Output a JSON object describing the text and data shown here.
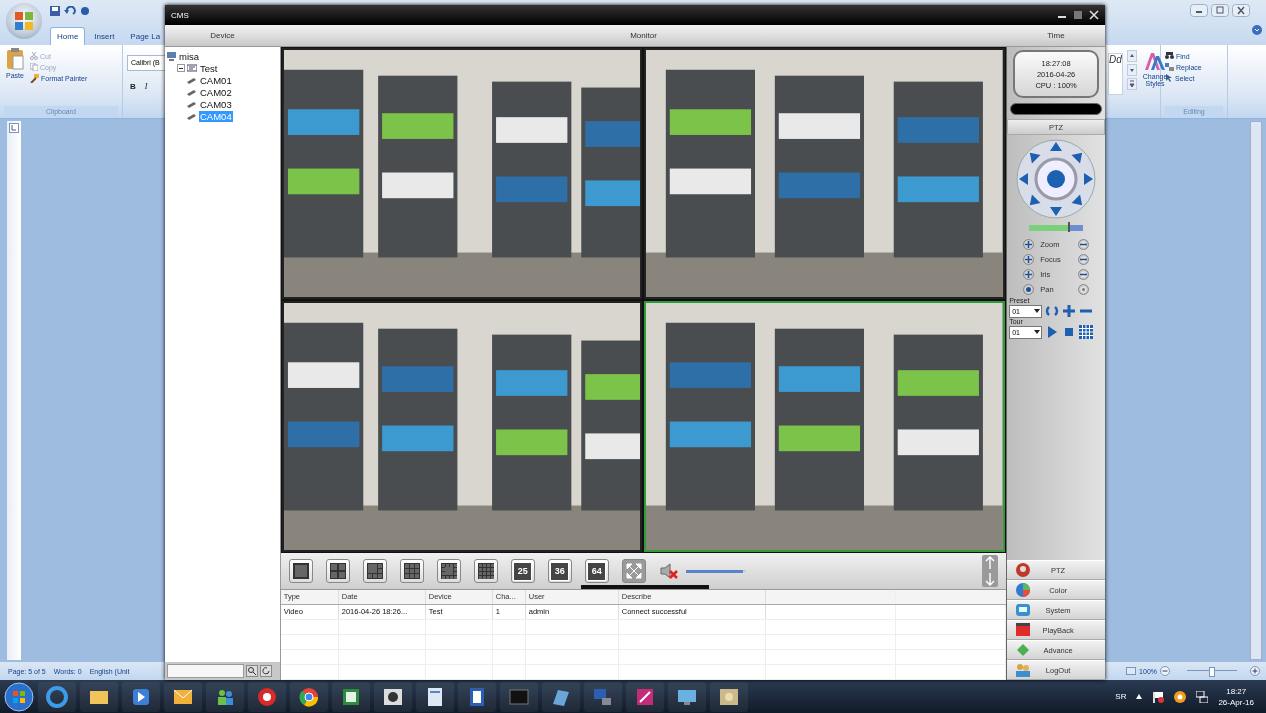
{
  "word": {
    "tabs": [
      {
        "label": "Home",
        "selected": true
      },
      {
        "label": "Insert",
        "selected": false
      },
      {
        "label": "Page La",
        "selected": false
      }
    ],
    "clipboard": {
      "paste": "Paste",
      "cut": "Cut",
      "copy": "Copy",
      "format_painter": "Format Painter",
      "group_label": "Clipboard"
    },
    "font": {
      "name": "Calibri (B",
      "bold": "B",
      "italic": "I"
    },
    "styles_preview": "Dd",
    "change_styles": "Change Styles",
    "editing": {
      "find": "Find",
      "replace": "Replace",
      "select": "Select",
      "group_label": "Editing"
    },
    "status_bar": {
      "page": "Page: 5 of 5",
      "words": "Words: 0",
      "language": "English (Unit",
      "zoom": "100%",
      "zoom_slider": {
        "level": 0.5
      }
    }
  },
  "cms": {
    "title": "CMS",
    "headers": [
      "Device",
      "Monitor",
      "Time"
    ],
    "tree": [
      {
        "label": "misa",
        "selected": false,
        "children": [
          {
            "label": "Test",
            "selected": false,
            "expanded": true,
            "children": [
              {
                "label": "CAM01",
                "selected": false
              },
              {
                "label": "CAM02",
                "selected": false
              },
              {
                "label": "CAM03",
                "selected": false
              },
              {
                "label": "CAM04",
                "selected": true
              }
            ]
          }
        ]
      }
    ],
    "panes": [
      {
        "kind": "picture",
        "selected": false
      },
      {
        "kind": "picture",
        "selected": false
      },
      {
        "kind": "picture",
        "selected": false
      },
      {
        "kind": "picture",
        "selected": true
      }
    ],
    "layout_buttons": [
      {
        "kind": "one"
      },
      {
        "kind": "four"
      },
      {
        "kind": "six"
      },
      {
        "kind": "nine"
      },
      {
        "kind": "eight"
      },
      {
        "kind": "sixteen"
      },
      {
        "kind": "number",
        "label": "25"
      },
      {
        "kind": "number",
        "label": "36"
      },
      {
        "kind": "number",
        "label": "64"
      },
      {
        "kind": "fullscreen"
      }
    ],
    "volume": {
      "muted": true,
      "level": 0.95
    },
    "log_table": {
      "columns": [
        "Type",
        "Date",
        "Device",
        "Cha...",
        "User",
        "Describe"
      ],
      "rows": [
        [
          "Video",
          "2016-04-26 18:26...",
          "Test",
          "1",
          "admin",
          "Connect successful"
        ]
      ]
    },
    "clock": {
      "time": "18:27:08",
      "date": "2016-04-26",
      "cpu": "CPU : 100%"
    },
    "ptz": {
      "title": "PTZ",
      "speed": {
        "level": 0.72
      },
      "controls": [
        {
          "label": "Zoom",
          "kind": "plusminus"
        },
        {
          "label": "Focus",
          "kind": "plusminus"
        },
        {
          "label": "Iris",
          "kind": "plusminus"
        },
        {
          "label": "Pan",
          "kind": "dots"
        }
      ],
      "preset": {
        "label": "Preset",
        "value": "01"
      },
      "tour": {
        "label": "Tour",
        "value": "01"
      }
    },
    "nav_buttons": [
      {
        "label": "PTZ"
      },
      {
        "label": "Color"
      },
      {
        "label": "System"
      },
      {
        "label": "PlayBack"
      },
      {
        "label": "Advance"
      },
      {
        "label": "LogOut"
      }
    ]
  },
  "taskbar": {
    "language": "SR",
    "time": "18:27",
    "date": "26-Apr-16"
  }
}
